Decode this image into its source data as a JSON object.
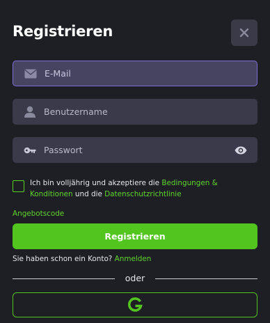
{
  "modal": {
    "title": "Registrieren",
    "close_icon": "close-icon"
  },
  "fields": {
    "email": {
      "placeholder": "E-Mail",
      "value": "",
      "icon": "mail-icon"
    },
    "username": {
      "placeholder": "Benutzername",
      "value": "",
      "icon": "user-icon"
    },
    "password": {
      "placeholder": "Passwort",
      "value": "",
      "icon": "key-icon",
      "toggle_icon": "eye-icon"
    }
  },
  "consent": {
    "checked": false,
    "prefix": "Ich bin volljährig und akzeptiere die ",
    "terms_link": "Bedingungen & Konditionen",
    "middle": " und die ",
    "privacy_link": "Datenschutzrichtlinie"
  },
  "promo_code_link": "Angebotscode",
  "submit_label": "Registrieren",
  "login": {
    "prompt": "Sie haben schon ein Konto? ",
    "link": "Anmelden"
  },
  "divider_label": "oder",
  "google_button": {
    "icon": "google-icon"
  },
  "colors": {
    "background": "#1e1e25",
    "field": "#3a3a4b",
    "focus_border": "#7a6fd6",
    "accent_green": "#53c51f",
    "link_green": "#5fd62a"
  }
}
